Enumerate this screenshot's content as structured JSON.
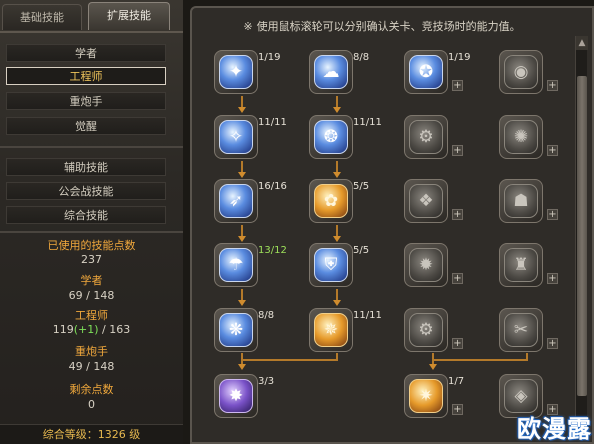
{
  "tabs": [
    {
      "label": "基础技能"
    },
    {
      "label": "扩展技能"
    }
  ],
  "menu": {
    "classes": [
      "学者",
      "工程师",
      "重炮手",
      "觉醒"
    ],
    "categories": [
      "辅助技能",
      "公会战技能",
      "综合技能"
    ]
  },
  "stats": {
    "used_label": "已使用的技能点数",
    "used_value": "237",
    "scholar_label": "学者",
    "scholar_value": "69 / 148",
    "engineer_label": "工程师",
    "engineer_base": "119",
    "engineer_bonus": "(+1)",
    "engineer_max": " / 163",
    "gunner_label": "重炮手",
    "gunner_value": "49 / 148",
    "remaining_label": "剩余点数",
    "remaining_value": "0",
    "total": "综合等级：1326 级"
  },
  "notice": "使用鼠标滚轮可以分别确认关卡、竞技场时的能力值。",
  "notice_star": "※",
  "skills": [
    {
      "level": "1/19",
      "icon": "charge-icon",
      "glyph": "✦"
    },
    {
      "level": "8/8",
      "icon": "cloud-icon",
      "glyph": "☁"
    },
    {
      "level": "1/19",
      "icon": "cannon-icon",
      "glyph": "✪"
    },
    {
      "level": "",
      "icon": "bag-icon",
      "glyph": "◉"
    },
    {
      "level": "11/11",
      "icon": "blaster-icon",
      "glyph": "✧"
    },
    {
      "level": "11/11",
      "icon": "flame-shield-icon",
      "glyph": "❂"
    },
    {
      "level": "",
      "icon": "gear-icon",
      "glyph": "⚙"
    },
    {
      "level": "",
      "icon": "vortex-icon",
      "glyph": "✺"
    },
    {
      "level": "16/16",
      "icon": "rocket-icon",
      "glyph": "➶"
    },
    {
      "level": "5/5",
      "icon": "octopus-icon",
      "glyph": "✿"
    },
    {
      "level": "",
      "icon": "turret-icon",
      "glyph": "❖"
    },
    {
      "level": "",
      "icon": "robot-icon",
      "glyph": "☗"
    },
    {
      "level": "13/12",
      "icon": "mushroom-icon",
      "glyph": "☂"
    },
    {
      "level": "5/5",
      "icon": "shield-icon",
      "glyph": "⛨"
    },
    {
      "level": "",
      "icon": "bomb-icon",
      "glyph": "✹"
    },
    {
      "level": "",
      "icon": "totem-icon",
      "glyph": "♜"
    },
    {
      "level": "8/8",
      "icon": "molecule-icon",
      "glyph": "❋"
    },
    {
      "level": "11/11",
      "icon": "swirl-icon",
      "glyph": "✵"
    },
    {
      "level": "",
      "icon": "cog-icon",
      "glyph": "⚙"
    },
    {
      "level": "",
      "icon": "wrench-icon",
      "glyph": "✂"
    },
    {
      "level": "3/3",
      "icon": "drill-icon",
      "glyph": "✸"
    },
    {
      "level": "1/7",
      "icon": "blast-icon",
      "glyph": "✷"
    },
    {
      "level": "",
      "icon": "lock-icon",
      "glyph": "◈"
    }
  ],
  "plus_label": "+",
  "watermark": "欧漫露"
}
